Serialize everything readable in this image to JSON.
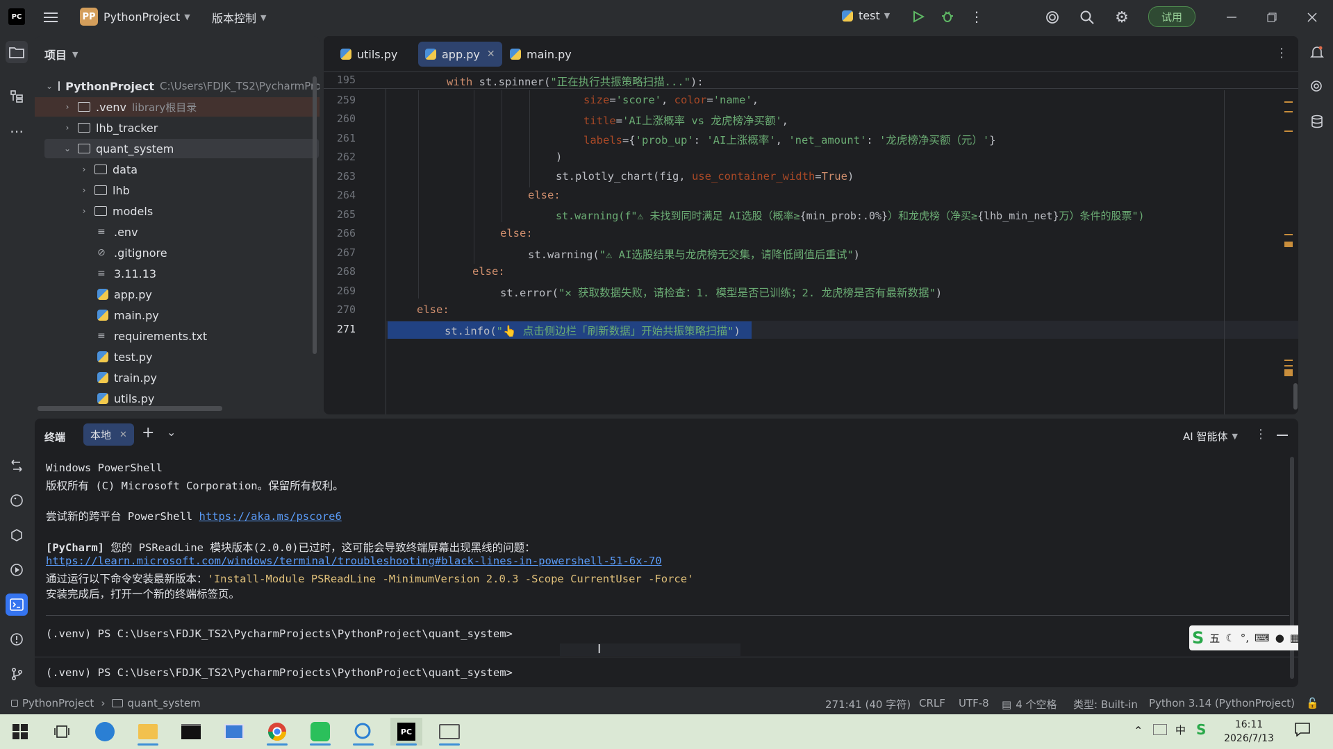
{
  "titlebar": {
    "project_badge": "PP",
    "project_name": "PythonProject",
    "vcs_label": "版本控制",
    "run_config": "test",
    "trial_label": "试用"
  },
  "project_panel": {
    "title": "项目",
    "root_name": "PythonProject",
    "root_path": "C:\\Users\\FDJK_TS2\\PycharmPro",
    "items": [
      {
        "label": ".venv",
        "hint": "library根目录"
      },
      {
        "label": "lhb_tracker"
      },
      {
        "label": "quant_system"
      },
      {
        "label": "data"
      },
      {
        "label": "lhb"
      },
      {
        "label": "models"
      },
      {
        "label": ".env"
      },
      {
        "label": ".gitignore"
      },
      {
        "label": "3.11.13"
      },
      {
        "label": "app.py"
      },
      {
        "label": "main.py"
      },
      {
        "label": "requirements.txt"
      },
      {
        "label": "test.py"
      },
      {
        "label": "train.py"
      },
      {
        "label": "utils.py"
      }
    ]
  },
  "editor": {
    "tabs": [
      {
        "label": "utils.py"
      },
      {
        "label": "app.py"
      },
      {
        "label": "main.py"
      }
    ],
    "inspections": {
      "warnings": "9",
      "weak": "10",
      "ok": "3"
    },
    "sticky_line": {
      "num": "195",
      "code": "with st.spinner(\"正在执行共振策略扫描...\"):"
    },
    "lines": [
      {
        "num": "259"
      },
      {
        "num": "260"
      },
      {
        "num": "261"
      },
      {
        "num": "262"
      },
      {
        "num": "263"
      },
      {
        "num": "264"
      },
      {
        "num": "265"
      },
      {
        "num": "266"
      },
      {
        "num": "267"
      },
      {
        "num": "268"
      },
      {
        "num": "269"
      },
      {
        "num": "270"
      },
      {
        "num": "271"
      }
    ],
    "code": {
      "l259": [
        "size",
        "=",
        "'score'",
        ", ",
        "color",
        "=",
        "'name'",
        ","
      ],
      "l260": [
        "title",
        "=",
        "'AI上涨概率 vs 龙虎榜净买额'",
        ","
      ],
      "l261": [
        "labels",
        "={",
        "'prob_up'",
        ": ",
        "'AI上涨概率'",
        ", ",
        "'net_amount'",
        ": ",
        "'龙虎榜净买额（元）'",
        "}"
      ],
      "l262": ")",
      "l263": [
        "st.plotly_chart(fig, ",
        "use_container_width",
        "=",
        "True",
        ")"
      ],
      "l264": "else:",
      "l265": [
        "st.warning(f\"",
        "⚠ 未找到同时满足 AI选股（概率≥",
        "{min_prob:.0%}",
        "）和龙虎榜（净买≥",
        "{lhb_min_net}",
        "万）条件的股票\")"
      ],
      "l266": "else:",
      "l267": [
        "st.warning(",
        "\"⚠ AI选股结果与龙虎榜无交集，请降低阈值后重试\"",
        ")"
      ],
      "l268": "else:",
      "l269": [
        "st.error(",
        "\"✕ 获取数据失败，请检查：1. 模型是否已训练；2. 龙虎榜是否有最新数据\"",
        ")"
      ],
      "l270": "else:",
      "l271": [
        "st.info(",
        "\"👆 点击侧边栏「刷新数据」开始共振策略扫描\"",
        ")"
      ]
    }
  },
  "terminal": {
    "title": "终端",
    "tab_label": "本地",
    "ai_label": "AI 智能体",
    "lines": {
      "t1": "Windows PowerShell",
      "t2": "版权所有 (C) Microsoft Corporation。保留所有权利。",
      "t3a": "尝试新的跨平台 PowerShell ",
      "t3b": "https://aka.ms/pscore6",
      "t4a": "[PyCharm]",
      "t4b": " 您的 PSReadLine 模块版本(2.0.0)已过时，这可能会导致终端屏幕出现黑线的问题：",
      "t5": "https://learn.microsoft.com/windows/terminal/troubleshooting#black-lines-in-powershell-51-6x-70",
      "t6a": "通过运行以下命令安装最新版本：",
      "t6b": "'Install-Module PSReadLine -MinimumVersion 2.0.3 -Scope CurrentUser -Force'",
      "t7": "安装完成后，打开一个新的终端标签页。",
      "prompt1": "(.venv) PS C:\\Users\\FDJK_TS2\\PycharmProjects\\PythonProject\\quant_system>",
      "prompt2": "(.venv) PS C:\\Users\\FDJK_TS2\\PycharmProjects\\PythonProject\\quant_system>"
    },
    "ime": {
      "mode": "五"
    }
  },
  "statusbar": {
    "crumb1": "PythonProject",
    "crumb2": "quant_system",
    "position": "271:41 (40 字符)",
    "line_sep": "CRLF",
    "encoding": "UTF-8",
    "indent": "4 个空格",
    "type": "类型: Built-in",
    "interpreter": "Python 3.14 (PythonProject)"
  },
  "taskbar": {
    "time": "16:11",
    "date": "2026/7/13",
    "ime": "中"
  }
}
